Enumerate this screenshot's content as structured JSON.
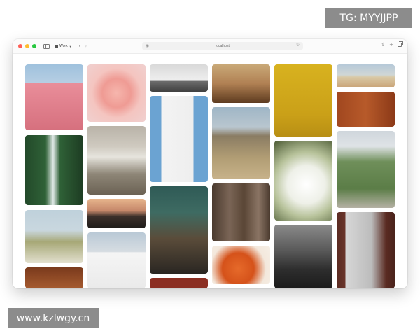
{
  "watermark_top": "TG: MYYJJPP",
  "watermark_bottom": "www.kzlwgy.cn",
  "browser": {
    "tab_group_label": "Work",
    "address": "localhost",
    "icons": {
      "close": "red-close-dot",
      "minimize": "yellow-minimize-dot",
      "zoom": "green-zoom-dot",
      "sidebar": "sidebar-toggle-icon",
      "back": "chevron-left-icon",
      "forward": "chevron-right-icon",
      "share": "share-icon",
      "new_tab": "plus-icon",
      "tabs": "tab-overview-icon"
    }
  },
  "gallery": {
    "photos": [
      {
        "name": "pink-building-photo"
      },
      {
        "name": "pink-rose-photo"
      },
      {
        "name": "white-chapel-on-hill-photo"
      },
      {
        "name": "cafe-chairs-photo"
      },
      {
        "name": "plant-yellow-wall-photo"
      },
      {
        "name": "beach-dunes-photo"
      },
      {
        "name": "wooden-door-photo"
      },
      {
        "name": "waterfall-photo"
      },
      {
        "name": "ocean-wave-photo"
      },
      {
        "name": "white-tower-blue-sky-photo"
      },
      {
        "name": "desert-hill-house-photo"
      },
      {
        "name": "white-flowers-photo"
      },
      {
        "name": "green-house-photo"
      },
      {
        "name": "daisy-field-photo"
      },
      {
        "name": "sunset-coast-photo"
      },
      {
        "name": "museum-statue-photo"
      },
      {
        "name": "tree-bark-photo"
      },
      {
        "name": "brooklyn-bridge-photo"
      },
      {
        "name": "white-facade-photo"
      },
      {
        "name": "orange-chair-photo"
      },
      {
        "name": "dark-interior-photo"
      },
      {
        "name": "wooden-ceiling-photo"
      },
      {
        "name": "red-bottom-photo"
      }
    ]
  }
}
